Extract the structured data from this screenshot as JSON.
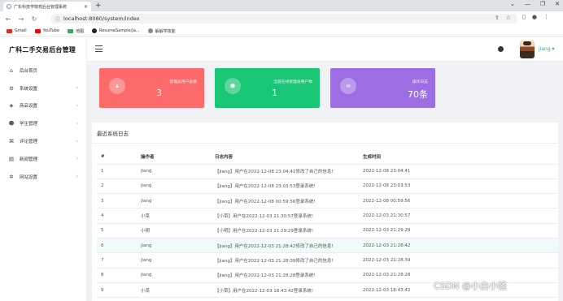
{
  "browser": {
    "tab_title": "广东科技学院校后台管理系统",
    "url": "localhost:8080/system/index",
    "bookmarks": [
      {
        "label": "Gmail",
        "color": "#d93025"
      },
      {
        "label": "YouTube",
        "color": "#ff0000"
      },
      {
        "label": "地图",
        "color": "#34a853"
      },
      {
        "label": "ResumeSample/ja...",
        "color": "#222222"
      },
      {
        "label": "解解学技能",
        "color": "#888888"
      }
    ]
  },
  "sidebar": {
    "brand": "广科二手交易后台管理",
    "items": [
      {
        "label": "后台首页",
        "icon": "home-icon",
        "glyph": "⌂",
        "arrow": ""
      },
      {
        "label": "系统设置",
        "icon": "gear-icon",
        "glyph": "⚙",
        "arrow": "›"
      },
      {
        "label": "商品设置",
        "icon": "cube-icon",
        "glyph": "◈",
        "arrow": "›"
      },
      {
        "label": "学生管理",
        "icon": "users-icon",
        "glyph": "☻",
        "arrow": "›"
      },
      {
        "label": "评论管理",
        "icon": "command-icon",
        "glyph": "⌘",
        "arrow": "›"
      },
      {
        "label": "新闻管理",
        "icon": "news-icon",
        "glyph": "▤",
        "arrow": "›"
      },
      {
        "label": "网站设置",
        "icon": "settings-icon",
        "glyph": "✲",
        "arrow": "›"
      }
    ]
  },
  "header": {
    "username": "jiang ▾"
  },
  "cards": [
    {
      "title": "管理员用户总数",
      "value": "3",
      "color": "#fc6a6a",
      "icon": "user-icon",
      "glyph": "♟"
    },
    {
      "title": "当前在线管理员用户数",
      "value": "1",
      "color": "#18c675",
      "icon": "group-icon",
      "glyph": "☻"
    },
    {
      "title": "操作日志",
      "value": "70条",
      "color": "#9b6fe3",
      "icon": "chat-icon",
      "glyph": "✉"
    }
  ],
  "logs": {
    "title": "最近系统日志",
    "columns": [
      "#",
      "操作者",
      "日志内容",
      "生成时间"
    ],
    "rows": [
      [
        "1",
        "jiang",
        "【jiang】用户在2022-12-08 23:04:41修改了自己的信息!",
        "2022-12-08 23:04:41"
      ],
      [
        "2",
        "jiang",
        "【jiang】用户在2022-12-08 23:03:53登录系统!",
        "2022-12-08 23:03:53"
      ],
      [
        "3",
        "jiang",
        "【jiang】用户在2022-12-08 00:59:56登录系统!",
        "2022-12-08 00:59:56"
      ],
      [
        "4",
        "小菜",
        "【小菜】用户在2022-12-03 21:30:57登录系统!",
        "2022-12-03 21:30:57"
      ],
      [
        "5",
        "小明",
        "【小明】用户在2022-12-03 21:29:29登录系统!",
        "2022-12-03 21:29:29"
      ],
      [
        "6",
        "jiang",
        "【jiang】用户在2022-12-03 21:28:42修改了自己的信息!",
        "2022-12-03 21:28:42"
      ],
      [
        "7",
        "jiang",
        "【jiang】用户在2022-12-03 21:28:39修改了自己的信息!",
        "2022-12-03 21:28:39"
      ],
      [
        "8",
        "jiang",
        "【jiang】用户在2022-12-03 21:28:28登录系统!",
        "2022-12-03 21:28:28"
      ],
      [
        "9",
        "小菜",
        "【小菜】用户在2022-12-03 18:43:42登录系统!",
        "2022-12-03 18:43:42"
      ]
    ]
  },
  "watermark": "CSDN @小白小怪"
}
